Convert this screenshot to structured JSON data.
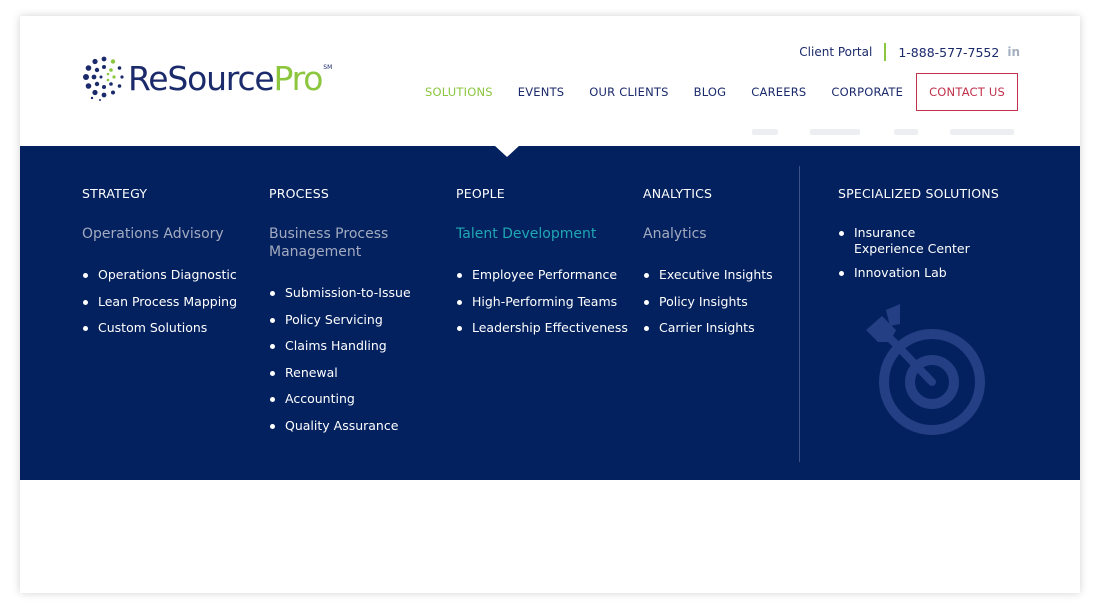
{
  "header": {
    "logo": {
      "text_re": "ReSource",
      "text_pro": "Pro",
      "mark": "SM",
      "icon": "dotted-circle-logo-icon"
    },
    "topbar": {
      "client_portal": "Client Portal",
      "phone": "1-888-577-7552",
      "social_icon": "linkedin-icon",
      "social_label": "in"
    },
    "nav": {
      "items": [
        {
          "label": "SOLUTIONS",
          "active": true
        },
        {
          "label": "EVENTS"
        },
        {
          "label": "OUR CLIENTS"
        },
        {
          "label": "BLOG"
        },
        {
          "label": "CAREERS"
        },
        {
          "label": "CORPORATE"
        }
      ],
      "contact": "CONTACT US"
    }
  },
  "mega_menu": {
    "columns": [
      {
        "title": "STRATEGY",
        "subtitle": "Operations Advisory",
        "items": [
          "Operations Diagnostic",
          "Lean Process Mapping",
          "Custom Solutions"
        ]
      },
      {
        "title": "PROCESS",
        "subtitle_line1": "Business Process",
        "subtitle_line2": "Management",
        "items": [
          "Submission-to-Issue",
          "Policy Servicing",
          "Claims Handling",
          "Renewal",
          "Accounting",
          "Quality Assurance"
        ]
      },
      {
        "title": "PEOPLE",
        "subtitle": "Talent Development",
        "items": [
          "Employee Performance",
          "High-Performing Teams",
          "Leadership Effectiveness"
        ]
      },
      {
        "title": "ANALYTICS",
        "subtitle": "Analytics",
        "items": [
          "Executive Insights",
          "Policy Insights",
          "Carrier Insights"
        ]
      }
    ],
    "specialized": {
      "title": "SPECIALIZED SOLUTIONS",
      "items": [
        "Insurance Experience Center",
        "Innovation Lab"
      ],
      "icon": "target-arrow-icon"
    }
  },
  "colors": {
    "navy": "#1b2a6b",
    "menu_bg": "#04215f",
    "green": "#8cc63f",
    "teal": "#1fa7b4",
    "contact_red": "#c0314a"
  }
}
